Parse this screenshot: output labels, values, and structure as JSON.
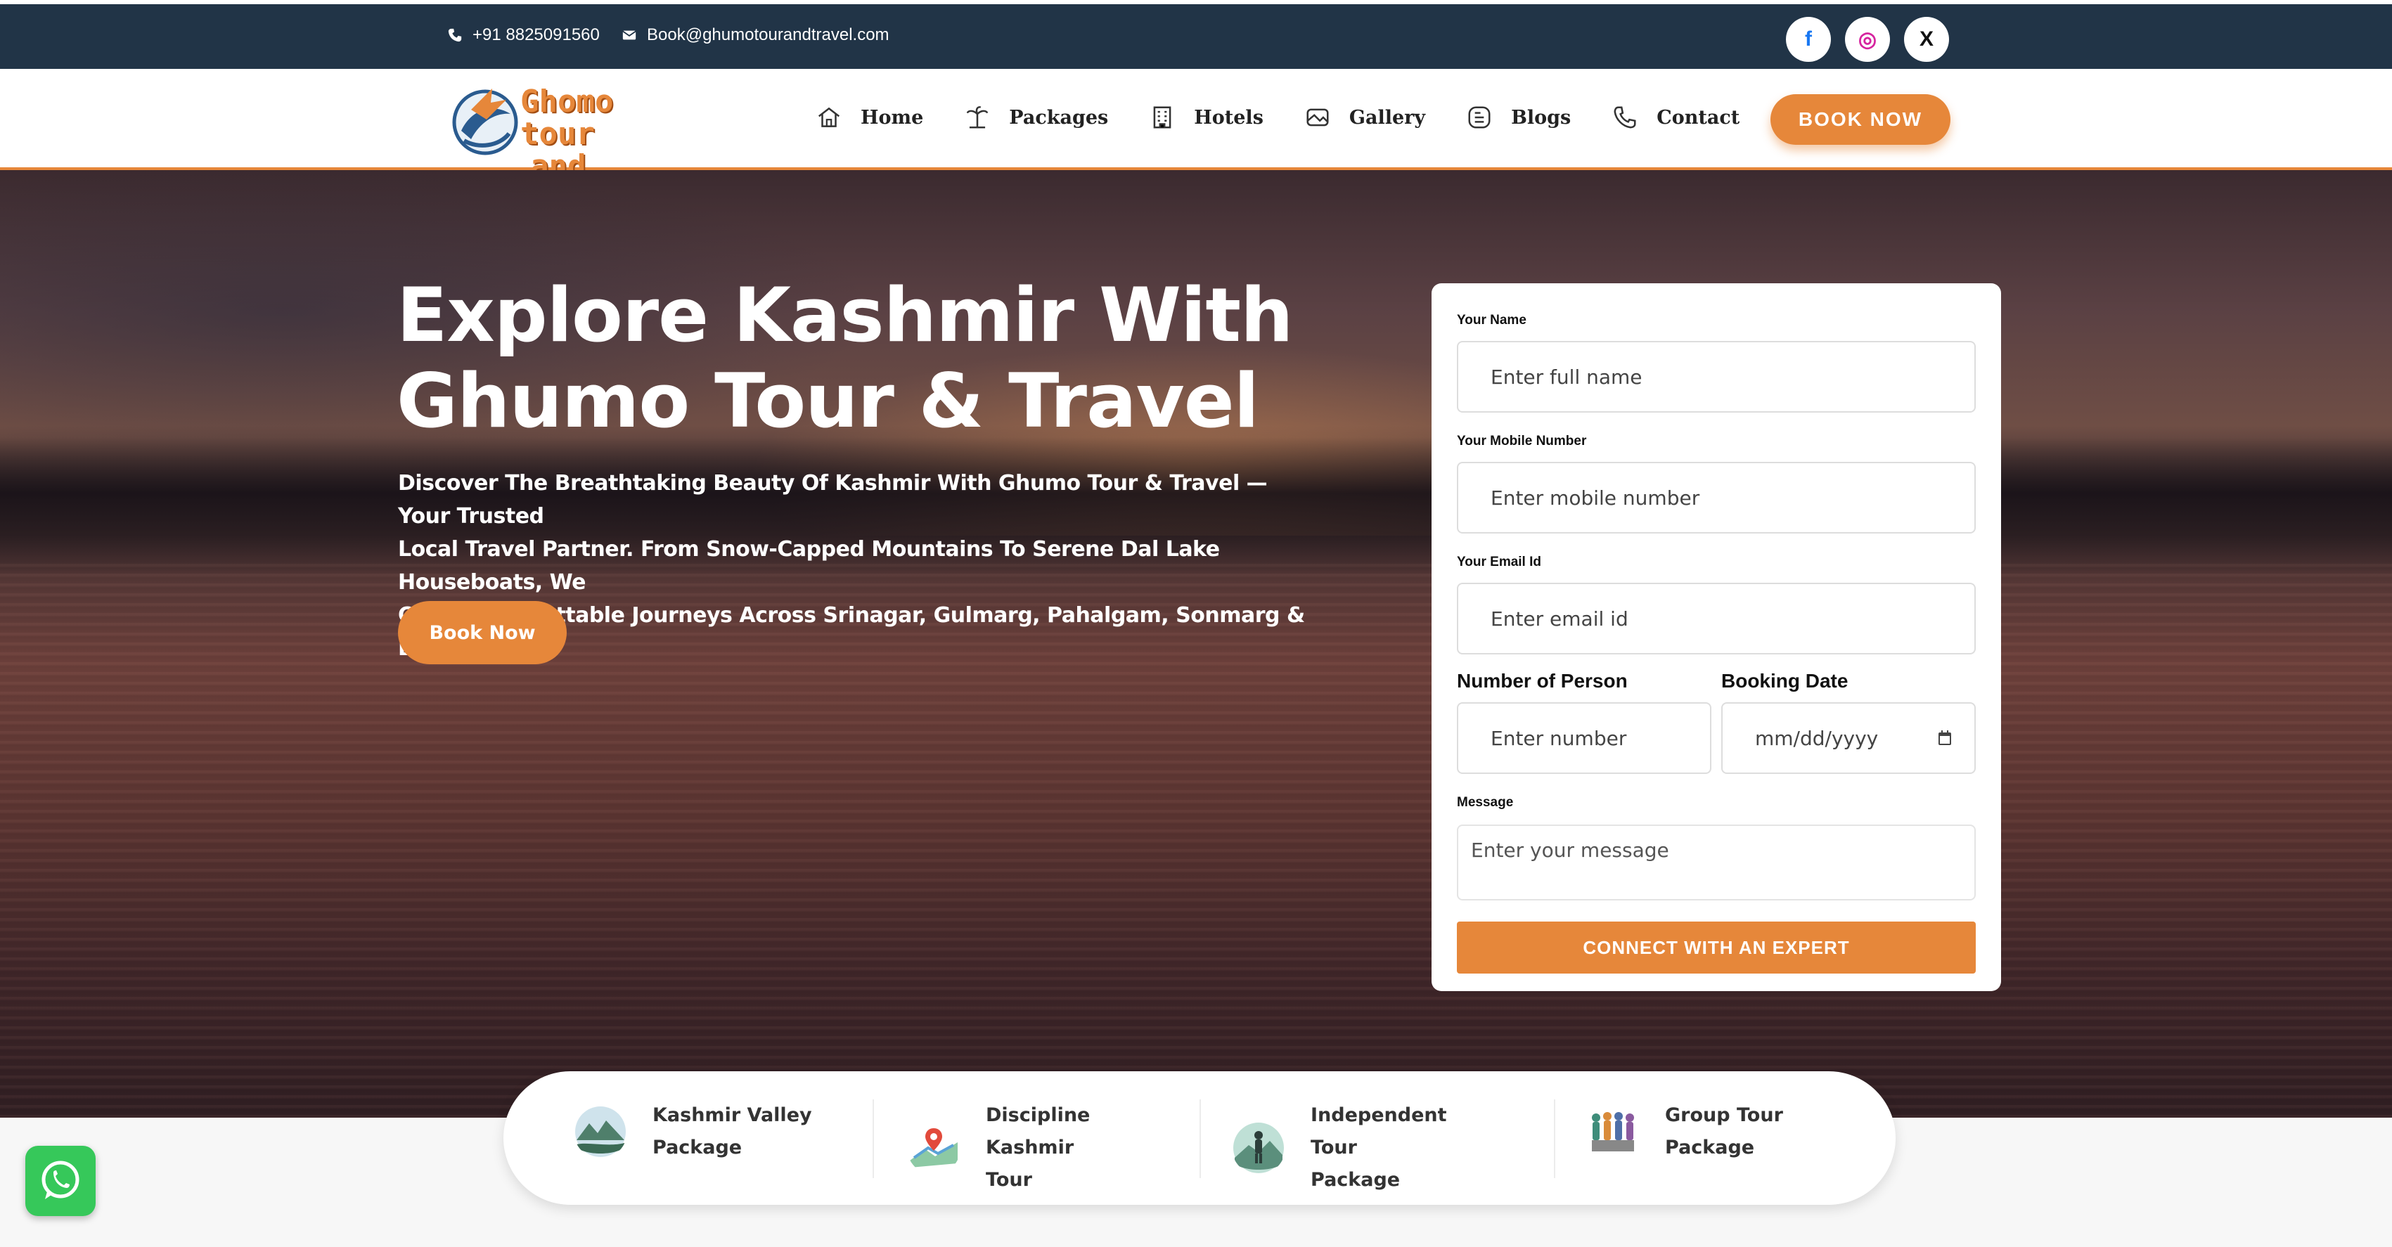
{
  "topbar": {
    "phone": "+91 8825091560",
    "email": "Book@ghumotourandtravel.com",
    "socials": [
      {
        "name": "facebook",
        "glyph": "f"
      },
      {
        "name": "instagram",
        "glyph": "◎"
      },
      {
        "name": "x",
        "glyph": "X"
      }
    ]
  },
  "nav": {
    "logo_line1": "Ghomo tour",
    "logo_line2": "and travel",
    "items": [
      {
        "label": "Home",
        "icon": "house-icon"
      },
      {
        "label": "Packages",
        "icon": "palm-tree-icon"
      },
      {
        "label": "Hotels",
        "icon": "building-icon"
      },
      {
        "label": "Gallery",
        "icon": "image-icon"
      },
      {
        "label": "Blogs",
        "icon": "blog-icon"
      },
      {
        "label": "Contact",
        "icon": "phone-icon"
      }
    ],
    "book_now": "BOOK NOW"
  },
  "hero": {
    "title_line1": "Explore Kashmir With",
    "title_line2": "Ghumo Tour & Travel",
    "desc_line1": "Discover The Breathtaking Beauty Of Kashmir With Ghumo Tour & Travel — Your Trusted",
    "desc_line2": "Local Travel Partner. From Snow-Capped Mountains To Serene Dal Lake Houseboats, We",
    "desc_line3": "Craft Unforgettable Journeys Across Srinagar, Gulmarg, Pahalgam, Sonmarg & Beyond.",
    "cta": "Book Now"
  },
  "form": {
    "name_label": "Your Name",
    "name_placeholder": "Enter full name",
    "mobile_label": "Your Mobile Number",
    "mobile_placeholder": "Enter mobile number",
    "email_label": "Your Email Id",
    "email_placeholder": "Enter email id",
    "persons_label": "Number of Person",
    "persons_placeholder": "Enter number",
    "date_label": "Booking Date",
    "date_placeholder": "mm/dd/yyyy",
    "message_label": "Message",
    "message_placeholder": "Enter your message",
    "submit": "CONNECT WITH AN EXPERT"
  },
  "packages": [
    {
      "line1": "Kashmir Valley",
      "line2": "Package"
    },
    {
      "line1": "Discipline Kashmir",
      "line2": "Tour"
    },
    {
      "line1": "Independent Tour",
      "line2": "Package"
    },
    {
      "line1": "Group Tour",
      "line2": "Package"
    }
  ],
  "colors": {
    "accent": "#e6873a",
    "topbar": "#213447",
    "whatsapp": "#36c85a"
  }
}
